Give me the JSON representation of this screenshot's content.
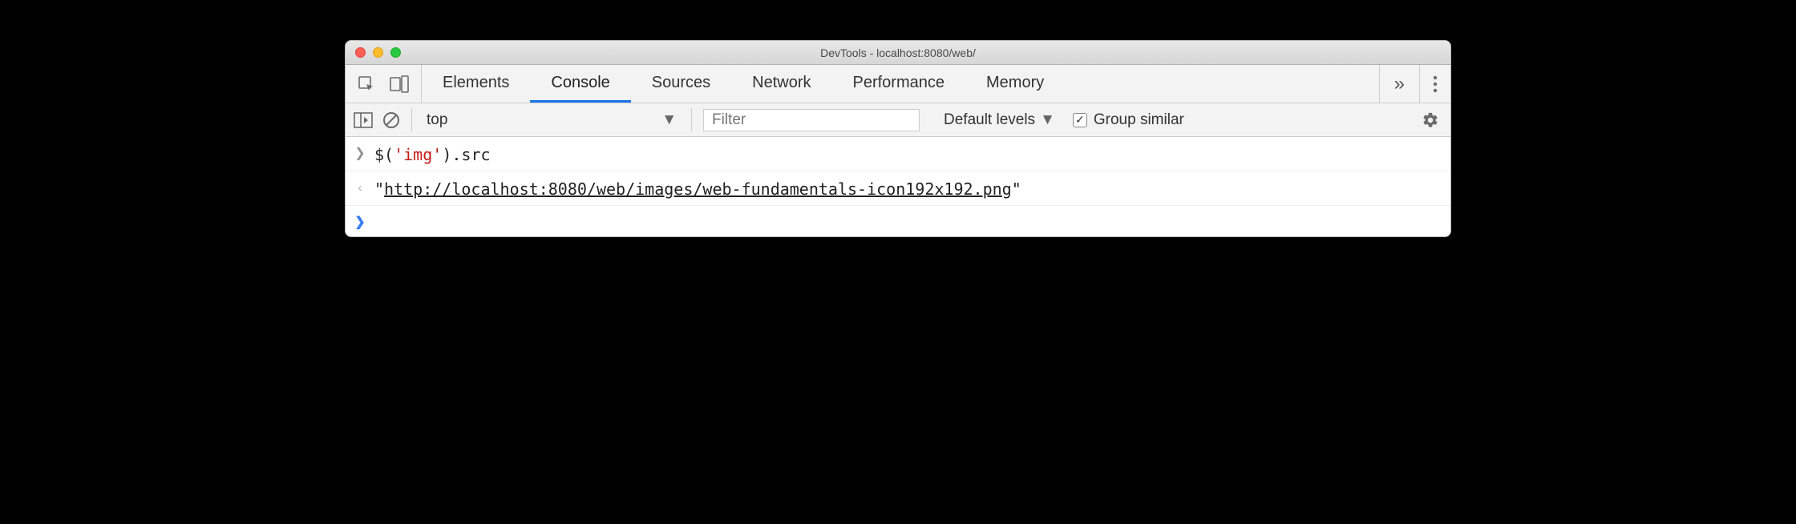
{
  "window": {
    "title": "DevTools - localhost:8080/web/"
  },
  "tabs": {
    "items": [
      "Elements",
      "Console",
      "Sources",
      "Network",
      "Performance",
      "Memory"
    ],
    "active_index": 1,
    "more_glyph": "»"
  },
  "toolbar": {
    "context": "top",
    "filter_placeholder": "Filter",
    "levels_label": "Default levels",
    "group_similar_label": "Group similar",
    "group_similar_checked": true
  },
  "console": {
    "input": {
      "fn": "$",
      "paren_open": "(",
      "arg": "'img'",
      "paren_close": ")",
      "dot": ".",
      "prop": "src"
    },
    "output": {
      "quote": "\"",
      "url": "http://localhost:8080/web/images/web-fundamentals-icon192x192.png"
    }
  }
}
